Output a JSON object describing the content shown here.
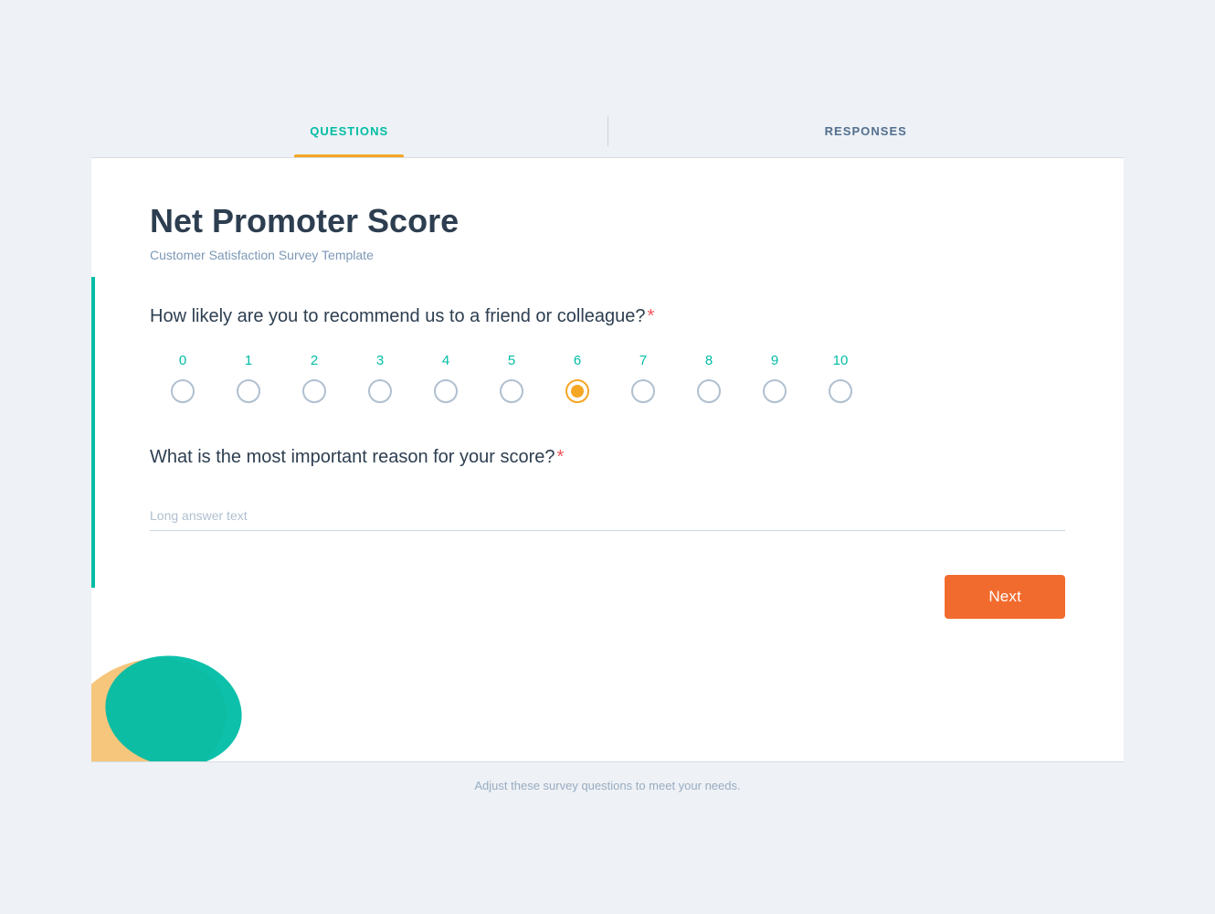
{
  "tabs": [
    {
      "id": "questions",
      "label": "QUESTIONS",
      "active": true
    },
    {
      "id": "responses",
      "label": "RESPONSES",
      "active": false
    }
  ],
  "card": {
    "title": "Net Promoter Score",
    "subtitle": "Customer Satisfaction Survey Template"
  },
  "question1": {
    "text": "How likely are you to recommend us to a friend or colleague?",
    "required": true,
    "scale": {
      "min": 0,
      "max": 10,
      "selected": 6
    }
  },
  "question2": {
    "text": "What is the most important reason for your score?",
    "required": true,
    "placeholder": "Long answer text"
  },
  "buttons": {
    "next": "Next"
  },
  "footer": {
    "text": "Adjust these survey questions to meet your needs."
  },
  "colors": {
    "accent_teal": "#00bda5",
    "accent_orange": "#f5a623",
    "button_orange": "#f26b2e",
    "required_red": "#f2545b"
  }
}
